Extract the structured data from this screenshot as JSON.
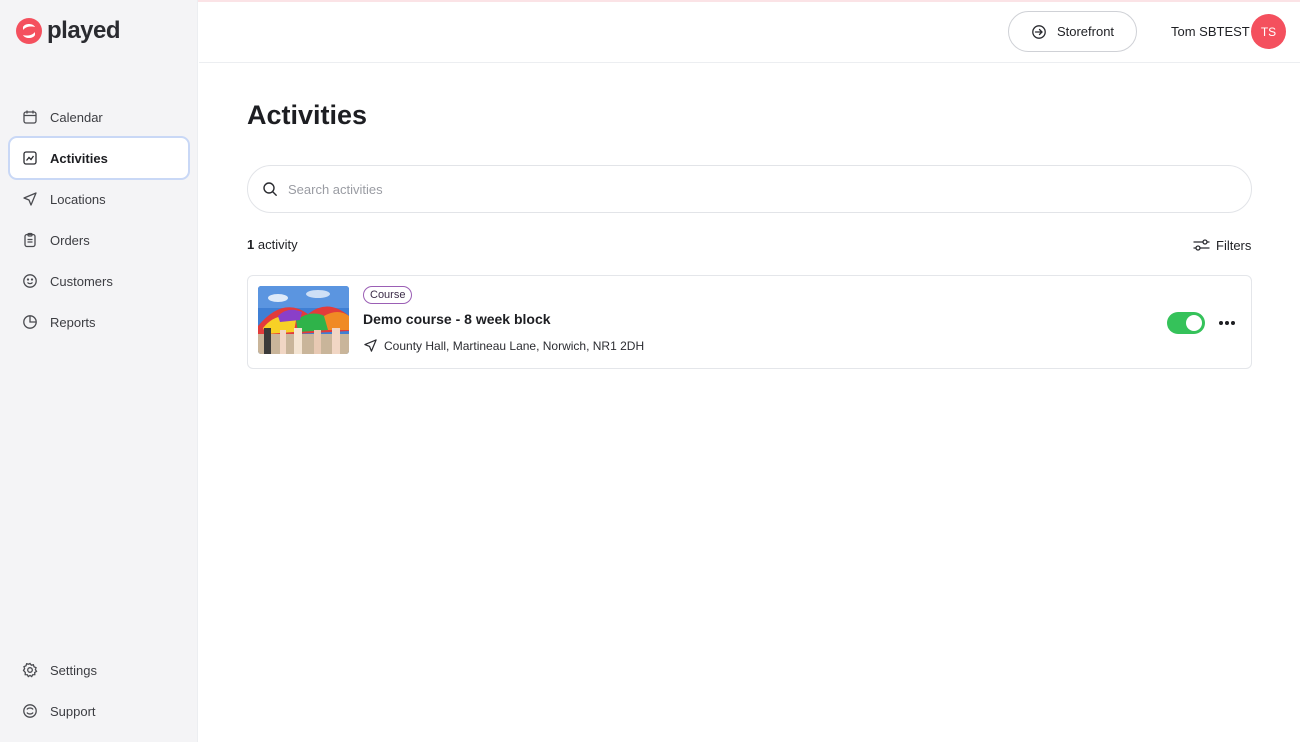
{
  "brand": {
    "name": "played",
    "accent": "#f4505e"
  },
  "sidebar": {
    "items": [
      {
        "label": "Calendar",
        "icon": "calendar-icon",
        "active": false
      },
      {
        "label": "Activities",
        "icon": "chart-line-icon",
        "active": true
      },
      {
        "label": "Locations",
        "icon": "navigation-icon",
        "active": false
      },
      {
        "label": "Orders",
        "icon": "clipboard-icon",
        "active": false
      },
      {
        "label": "Customers",
        "icon": "smile-icon",
        "active": false
      },
      {
        "label": "Reports",
        "icon": "pie-chart-icon",
        "active": false
      }
    ],
    "bottom_items": [
      {
        "label": "Settings",
        "icon": "gear-icon"
      },
      {
        "label": "Support",
        "icon": "support-icon"
      }
    ]
  },
  "header": {
    "storefront_label": "Storefront",
    "user_name": "Tom SBTEST",
    "avatar_initials": "TS"
  },
  "main": {
    "title": "Activities",
    "search_placeholder": "Search activities",
    "count_number": "1",
    "count_label": " activity",
    "filters_label": "Filters",
    "activities": [
      {
        "badge": "Course",
        "title": "Demo course - 8 week block",
        "location": "County Hall, Martineau Lane, Norwich, NR1 2DH",
        "enabled": true
      }
    ]
  },
  "colors": {
    "toggle_on": "#35c25a",
    "active_border": "#c9d8f6",
    "badge_border": "#9b5fb5"
  }
}
